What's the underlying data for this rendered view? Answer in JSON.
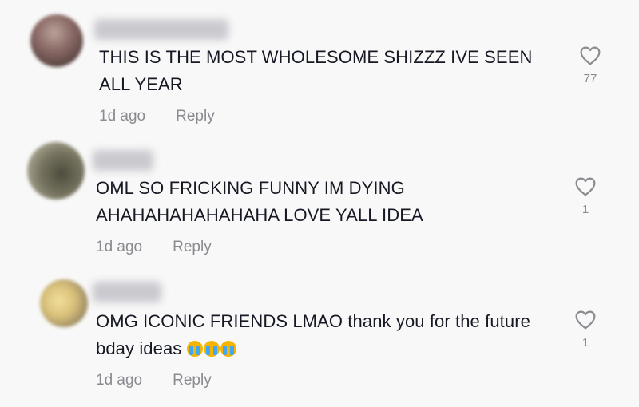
{
  "comments": [
    {
      "text": "THIS IS THE MOST WHOLESOME SHIZZZ IVE SEEN\nALL YEAR",
      "time": "1d ago",
      "reply_label": "Reply",
      "likes": "77",
      "avatar_color": "#8b6a66"
    },
    {
      "text": "OML SO FRICKING FUNNY IM DYING\nAHAHAHAHAHAHAHA LOVE YALL IDEA",
      "time": "1d ago",
      "reply_label": "Reply",
      "likes": "1",
      "avatar_color": "#76745f"
    },
    {
      "text": "OMG ICONIC FRIENDS LMAO thank you for the future\nbday ideas",
      "emoji_names": [
        "loudly-crying-face",
        "loudly-crying-face",
        "loudly-crying-face"
      ],
      "time": "1d ago",
      "reply_label": "Reply",
      "likes": "1",
      "avatar_color": "#d8c07a"
    }
  ],
  "icons": {
    "like": "heart-outline-icon"
  },
  "colors": {
    "background": "#f8f8f8",
    "text": "#161823",
    "muted": "#8a8b91"
  }
}
